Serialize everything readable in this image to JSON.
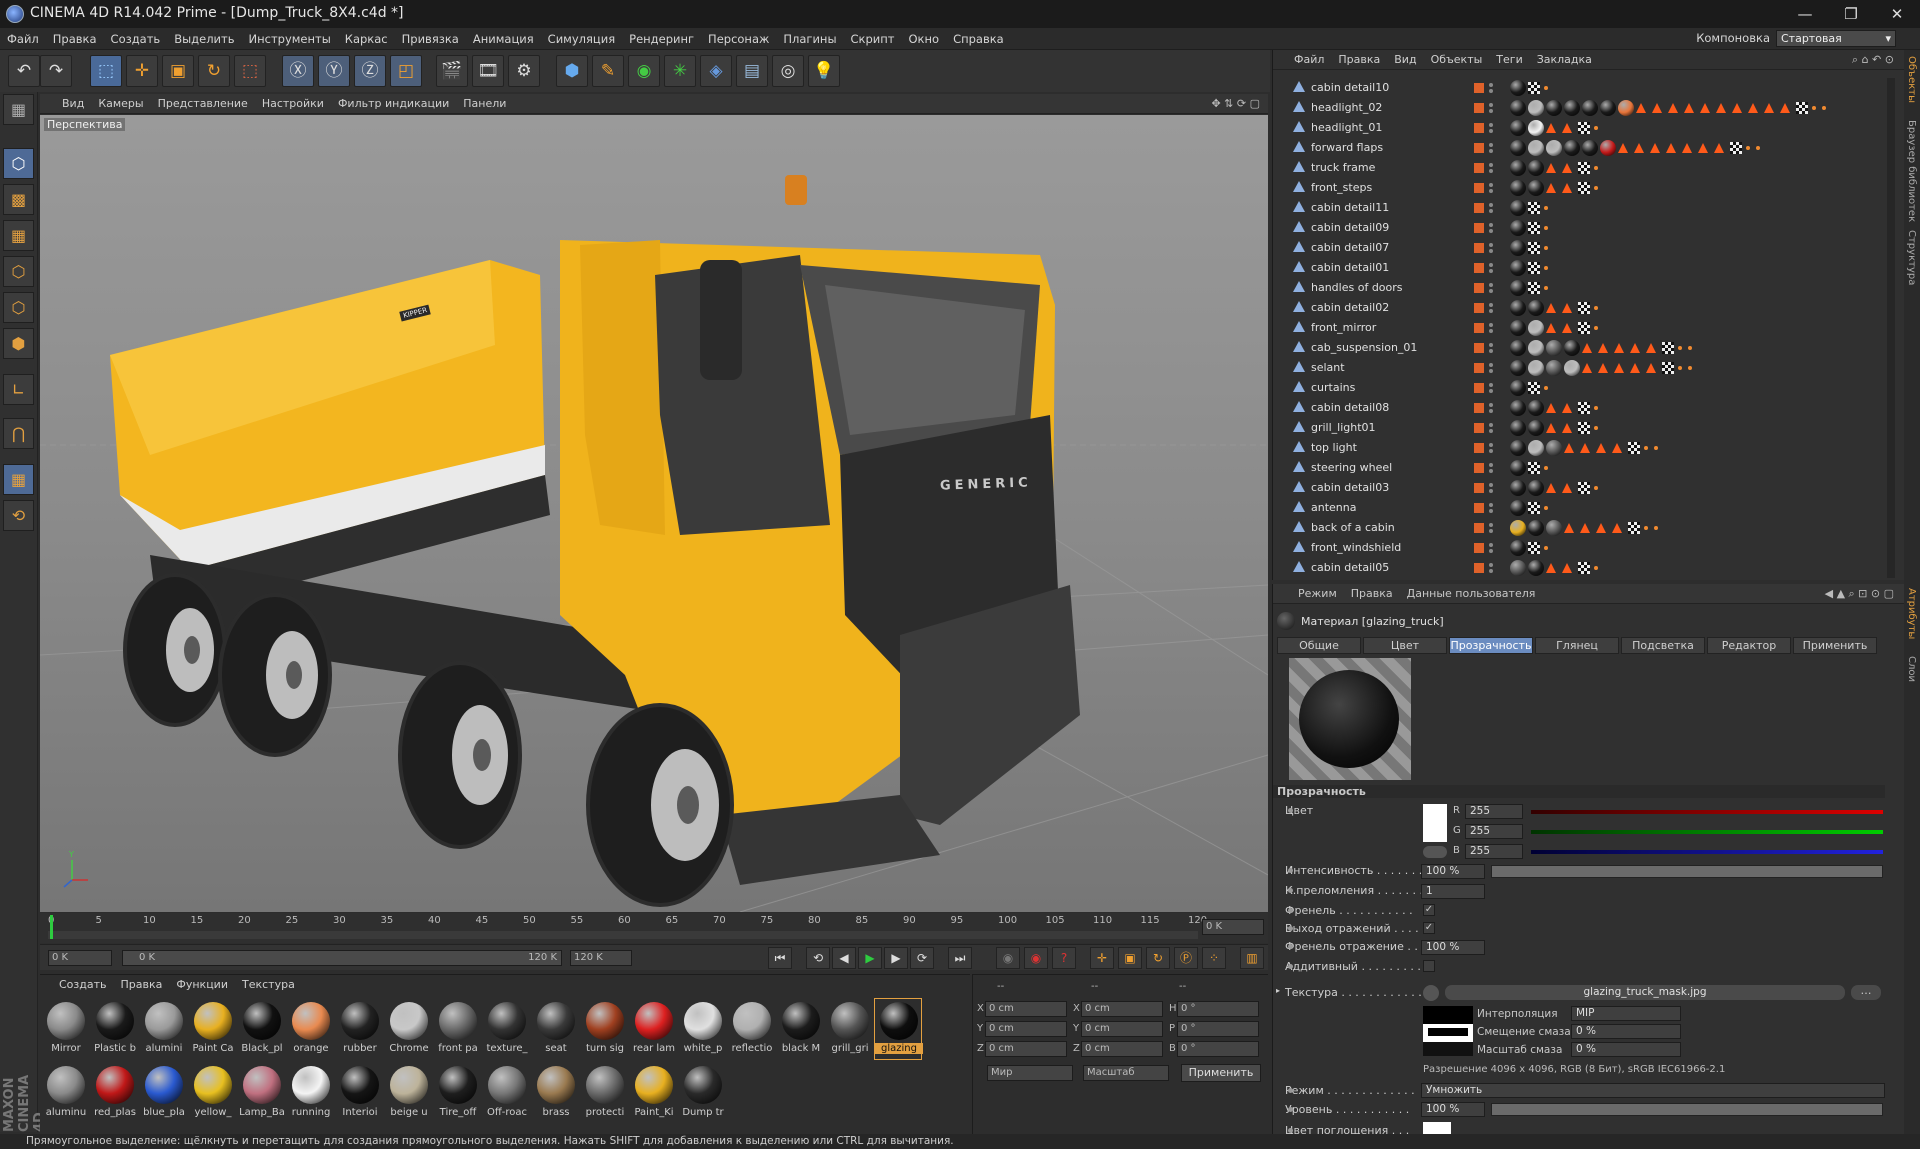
{
  "title_bar": {
    "text": "CINEMA 4D R14.042 Prime - [Dump_Truck_8X4.c4d *]",
    "minimize": "—",
    "maximize": "❐",
    "close": "✕"
  },
  "menu": [
    "Файл",
    "Правка",
    "Создать",
    "Выделить",
    "Инструменты",
    "Каркас",
    "Привязка",
    "Анимация",
    "Симуляция",
    "Рендеринг",
    "Персонаж",
    "Плагины",
    "Скрипт",
    "Окно",
    "Справка"
  ],
  "layout": {
    "label": "Компоновка",
    "value": "Стартовая"
  },
  "viewport": {
    "menu": [
      "Вид",
      "Камеры",
      "Представление",
      "Настройки",
      "Фильтр индикации",
      "Панели"
    ],
    "label": "Перспектива",
    "truck_brand": "GENERIC",
    "tipper_label": "KIPPER"
  },
  "timeline": {
    "ticks": [
      "0",
      "5",
      "10",
      "15",
      "20",
      "25",
      "30",
      "35",
      "40",
      "45",
      "50",
      "55",
      "60",
      "65",
      "70",
      "75",
      "80",
      "85",
      "90",
      "95",
      "100",
      "105",
      "110",
      "115",
      "120"
    ],
    "current_frame": "0 K",
    "start_field": "0 K",
    "slider_left": "0 K",
    "slider_right": "120 K",
    "end_field": "120 K"
  },
  "material_manager": {
    "menu": [
      "Создать",
      "Правка",
      "Функции",
      "Текстура"
    ],
    "materials_row1": [
      {
        "name": "Mirror",
        "color": "#8a8a8a"
      },
      {
        "name": "Plastic b",
        "color": "#1a1a1a"
      },
      {
        "name": "alumini",
        "color": "#9a9a9a"
      },
      {
        "name": "Paint Ca",
        "color": "#e8b020"
      },
      {
        "name": "Black_pl",
        "color": "#111111"
      },
      {
        "name": "orange",
        "color": "#e98a50"
      },
      {
        "name": "rubber",
        "color": "#222222"
      },
      {
        "name": "Chrome",
        "color": "#c8c8c8"
      },
      {
        "name": "front pa",
        "color": "#6a6a6a"
      },
      {
        "name": "texture_",
        "color": "#333333"
      },
      {
        "name": "seat",
        "color": "#3a3a3a"
      },
      {
        "name": "turn sig",
        "color": "#a04020"
      },
      {
        "name": "rear lam",
        "color": "#dd2020"
      },
      {
        "name": "white_p",
        "color": "#e0e0e0"
      },
      {
        "name": "reflectio",
        "color": "#b0b0b0"
      },
      {
        "name": "black M",
        "color": "#1c1c1c"
      },
      {
        "name": "grill_gri",
        "color": "#555555"
      },
      {
        "name": "glazing",
        "color": "#0e0e0e"
      }
    ],
    "materials_row2": [
      {
        "name": "aluminu",
        "color": "#8a8a8a"
      },
      {
        "name": "red_plas",
        "color": "#c01818"
      },
      {
        "name": "blue_pla",
        "color": "#2a5ad0"
      },
      {
        "name": "yellow_",
        "color": "#e8c020"
      },
      {
        "name": "Lamp_Ba",
        "color": "#c07080"
      },
      {
        "name": "running",
        "color": "#f4f4f4"
      },
      {
        "name": "Interioi",
        "color": "#151515"
      },
      {
        "name": "beige u",
        "color": "#bdb39a"
      },
      {
        "name": "Tire_off",
        "color": "#1e1e1e"
      },
      {
        "name": "Off-roac",
        "color": "#777777"
      },
      {
        "name": "brass",
        "color": "#9a7a50"
      },
      {
        "name": "protecti",
        "color": "#6a6a6a"
      },
      {
        "name": "Paint_Ki",
        "color": "#e8b020"
      },
      {
        "name": "Dump tr",
        "color": "#2a2a2a"
      }
    ]
  },
  "coordinates": {
    "headers": [
      "--",
      "--",
      "--"
    ],
    "rows": [
      {
        "a": "X",
        "av": "0 cm",
        "b": "X",
        "bv": "0 cm",
        "c": "H",
        "cv": "0 °"
      },
      {
        "a": "Y",
        "av": "0 cm",
        "b": "Y",
        "bv": "0 cm",
        "c": "P",
        "cv": "0 °"
      },
      {
        "a": "Z",
        "av": "0 cm",
        "b": "Z",
        "bv": "0 cm",
        "c": "B",
        "cv": "0 °"
      }
    ],
    "space": "Мир",
    "scale": "Масштаб",
    "apply": "Применить"
  },
  "object_manager": {
    "menu": [
      "Файл",
      "Правка",
      "Вид",
      "Объекты",
      "Теги",
      "Закладка"
    ],
    "objects": [
      {
        "name": "cabin detail10",
        "tags": "bc"
      },
      {
        "name": "headlight_02",
        "tags": "bwbbbboT9cd"
      },
      {
        "name": "headlight_01",
        "tags": "bWTTc"
      },
      {
        "name": "forward flaps",
        "tags": "bwwbbrT6cd"
      },
      {
        "name": "truck frame",
        "tags": "bbTTc"
      },
      {
        "name": "front_steps",
        "tags": "bbTTc"
      },
      {
        "name": "cabin detail11",
        "tags": "bc"
      },
      {
        "name": "cabin detail09",
        "tags": "bc"
      },
      {
        "name": "cabin detail07",
        "tags": "bc"
      },
      {
        "name": "cabin detail01",
        "tags": "bc"
      },
      {
        "name": "handles of doors",
        "tags": "bc"
      },
      {
        "name": "cabin detail02",
        "tags": "bbTTc"
      },
      {
        "name": "front_mirror",
        "tags": "bwTTc"
      },
      {
        "name": "cab_suspension_01",
        "tags": "bwkbT4cd"
      },
      {
        "name": "selant",
        "tags": "bwkwT4cd"
      },
      {
        "name": "curtains",
        "tags": "bc"
      },
      {
        "name": "cabin detail08",
        "tags": "bbTTc"
      },
      {
        "name": "grill_light01",
        "tags": "bbTTc"
      },
      {
        "name": "top light",
        "tags": "bwkT3cd"
      },
      {
        "name": "steering wheel",
        "tags": "bc"
      },
      {
        "name": "cabin detail03",
        "tags": "bbTTc"
      },
      {
        "name": "antenna",
        "tags": "bc"
      },
      {
        "name": "back of a cabin",
        "tags": "ybkT3cd"
      },
      {
        "name": "front_windshield",
        "tags": "bc"
      },
      {
        "name": "cabin detail05",
        "tags": "kbTTc"
      }
    ]
  },
  "attribute_manager": {
    "menu": [
      "Режим",
      "Правка",
      "Данные пользователя"
    ],
    "title": "Материал [glazing_truck]",
    "tabs": [
      "Общие",
      "Цвет",
      "Прозрачность",
      "Глянец",
      "Подсветка",
      "Редактор",
      "Применить"
    ],
    "active_tab": "Прозрачность",
    "section": "Прозрачность",
    "color_label": "Цвет",
    "r": "255",
    "g": "255",
    "b": "255",
    "intensity_label": "Интенсивность",
    "intensity": "100 %",
    "intensity_level": 1.0,
    "ior_label": "К.преломления",
    "ior": "1",
    "fresnel_label": "Френель",
    "exit_refl_label": "Выход отражений",
    "fresnel_refl_label": "Френель отражение",
    "fresnel_refl": "100 %",
    "additive_label": "Аддитивный",
    "texture_label": "Текстура",
    "texture_file": "glazing_truck_mask.jpg",
    "interp_label": "Интерполяция",
    "interp": "MIP",
    "blur_offset_label": "Смещение смаза",
    "blur_offset": "0 %",
    "blur_scale_label": "Масштаб смаза",
    "blur_scale": "0 %",
    "resolution": "Разрешение 4096 x 4096, RGB (8 Бит), sRGB IEC61966-2.1",
    "mode_label": "Режим",
    "mode": "Умножить",
    "level_label": "Уровень",
    "level": "100 %",
    "level_value": 1.0,
    "absorption_label": "Цвет поглощения",
    "r_lbl": "R",
    "g_lbl": "G",
    "b_lbl": "B"
  },
  "right_strip": [
    "Объекты",
    "Браузер библиотек",
    "Структура",
    "Атрибуты",
    "Слои"
  ],
  "status": "Прямоугольное выделение: щёлкнуть и перетащить для создания прямоугольного выделения. Нажать SHIFT для добавления к выделению или CTRL для вычитания.",
  "colors": {
    "accent": "#6b8cc0",
    "truck_yellow": "#f2b41e",
    "tag_orange": "#ff5a1a",
    "layer_orange": "#e0622a"
  }
}
